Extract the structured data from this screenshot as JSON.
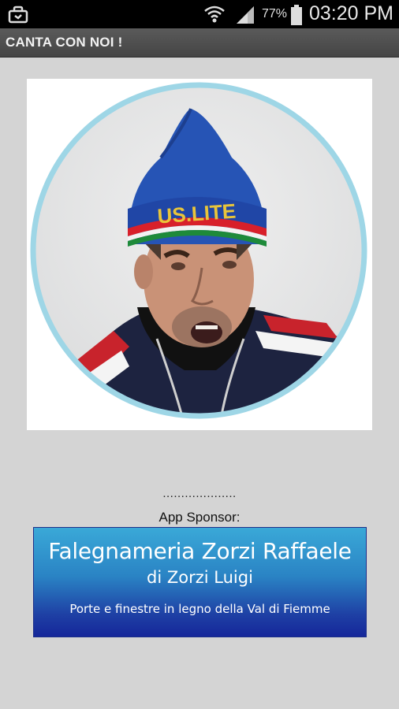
{
  "status_bar": {
    "battery_percent": "77%",
    "time": "03:20 PM",
    "icons": [
      "briefcase-notification-icon",
      "wifi-icon",
      "signal-icon",
      "battery-icon"
    ]
  },
  "action_bar": {
    "title": "CANTA CON NOI !"
  },
  "photo": {
    "ring_color": "#9ed6e6",
    "hat_text": "US.LITE"
  },
  "sponsor": {
    "dots": "....................",
    "label": "App Sponsor:",
    "banner": {
      "title": "Falegnameria Zorzi Raffaele",
      "subtitle": "di Zorzi Luigi",
      "description": "Porte e finestre in legno della Val di Fiemme"
    }
  }
}
